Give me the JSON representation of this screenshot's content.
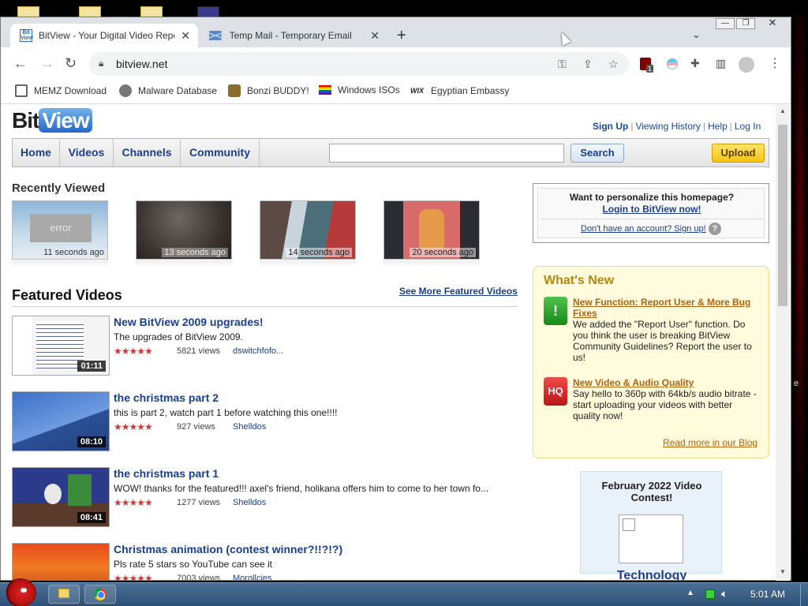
{
  "browser": {
    "tabs": [
      {
        "title": "BitView - Your Digital Video Repository",
        "active": true
      },
      {
        "title": "Temp Mail - Temporary Email",
        "active": false
      }
    ],
    "url": "bitview.net",
    "bookmarks": [
      "MEMZ Download",
      "Malware Database",
      "Bonzi BUDDY!",
      "Windows ISOs",
      "Egyptian Embassy"
    ],
    "ublock_badge": "1"
  },
  "site": {
    "logo_bit": "Bit",
    "logo_view": "View",
    "toplinks": [
      "Sign Up",
      "Viewing History",
      "Help",
      "Log In"
    ],
    "nav": [
      "Home",
      "Videos",
      "Channels",
      "Community"
    ],
    "search_label": "Search",
    "upload_label": "Upload",
    "recent_heading": "Recently Viewed",
    "recent": [
      {
        "time": "11 seconds ago",
        "thumb_text": "error"
      },
      {
        "time": "13 seconds ago"
      },
      {
        "time": "14 seconds ago"
      },
      {
        "time": "20 seconds ago"
      }
    ],
    "featured_heading": "Featured Videos",
    "see_more": "See More Featured Videos",
    "videos": [
      {
        "title": "New BitView 2009 upgrades!",
        "desc": "The upgrades of BitView 2009.",
        "stars": "★★★★★",
        "views": "5821 views",
        "user": "dswitchfofo...",
        "duration": "01:11"
      },
      {
        "title": "the christmas part 2",
        "desc": "this is part 2, watch part 1 before watching this one!!!!",
        "stars": "★★★★★",
        "views": "927 views",
        "user": "Shelldos",
        "duration": "08:10"
      },
      {
        "title": "the christmas part 1",
        "desc": "WOW! thanks for the featured!!! axel's friend, holikana offers him to come to her town fo...",
        "stars": "★★★★★",
        "views": "1277 views",
        "user": "Shelldos",
        "duration": "08:41"
      },
      {
        "title": "Christmas animation (contest winner?!!?!?)",
        "desc": "Pls rate 5 stars so YouTube can see it",
        "stars": "★★★★★",
        "views": "7003 views",
        "user": "Morollcies",
        "duration": ""
      }
    ],
    "personalize": {
      "question": "Want to personalize this homepage?",
      "login": "Login to BitView now!",
      "signup": "Don't have an account? Sign up!",
      "help": "?"
    },
    "whats_new": {
      "heading": "What's New",
      "items": [
        {
          "icon": "!",
          "title": "New Function: Report User & More Bug Fixes",
          "body": "We added the \"Report User\" function. Do you think the user is breaking BitView Community Guidelines? Report the user to us!"
        },
        {
          "icon": "HQ",
          "title": "New Video & Audio Quality",
          "body": "Say hello to 360p with 64kb/s audio bitrate - start uploading your videos with better quality now!"
        }
      ],
      "blog": "Read more in our Blog"
    },
    "contest": {
      "title": "February 2022 Video Contest!",
      "category": "Technology"
    }
  },
  "taskbar": {
    "clock": "5:01 AM"
  },
  "desktop": {
    "right_text": "e"
  }
}
